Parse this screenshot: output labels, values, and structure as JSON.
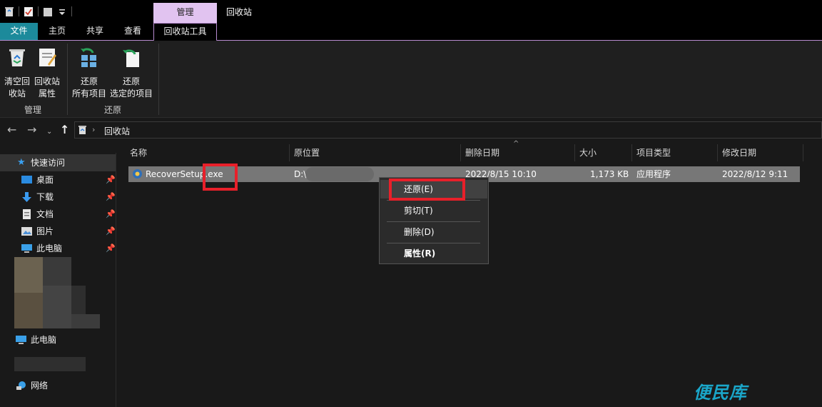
{
  "titlebar": {
    "contextual_tab": "管理",
    "window_title": "回收站",
    "qat_icons": [
      "recycle-bin-icon",
      "properties-icon",
      "folder-icon",
      "dropdown-icon"
    ]
  },
  "ribbon_tabs": {
    "file": "文件",
    "home": "主页",
    "share": "共享",
    "view": "查看",
    "tools": "回收站工具"
  },
  "ribbon": {
    "empty_bin": "清空回收站",
    "empty_bin_l1": "清空回",
    "empty_bin_l2": "收站",
    "bin_props_l1": "回收站",
    "bin_props_l2": "属性",
    "restore_all_l1": "还原",
    "restore_all_l2": "所有项目",
    "restore_sel_l1": "还原",
    "restore_sel_l2": "选定的项目",
    "group_manage": "管理",
    "group_restore": "还原"
  },
  "address": {
    "path": "回收站",
    "icons": [
      "back-arrow-icon",
      "forward-arrow-icon",
      "recent-dropdown-icon",
      "up-arrow-icon",
      "recycle-bin-icon"
    ]
  },
  "sidebar": {
    "quick_access": "快速访问",
    "items": [
      {
        "label": "桌面",
        "icon": "desktop-icon"
      },
      {
        "label": "下载",
        "icon": "download-icon"
      },
      {
        "label": "文档",
        "icon": "document-icon"
      },
      {
        "label": "图片",
        "icon": "pictures-icon"
      },
      {
        "label": "此电脑",
        "icon": "computer-icon"
      }
    ],
    "this_pc": "此电脑",
    "network": "网络"
  },
  "columns": {
    "name": "名称",
    "original_location": "原位置",
    "date_deleted": "删除日期",
    "size": "大小",
    "item_type": "项目类型",
    "date_modified": "修改日期"
  },
  "file_row": {
    "name_prefix": "RecoverSetup",
    "name_suffix": ".exe",
    "location": "D:\\",
    "date_deleted": "2022/8/15 10:10",
    "size": "1,173 KB",
    "type": "应用程序",
    "date_modified": "2022/8/12 9:11"
  },
  "context_menu": {
    "restore": "还原(E)",
    "cut": "剪切(T)",
    "delete": "删除(D)",
    "properties": "属性(R)"
  },
  "watermark": "便民库",
  "colors": {
    "accent_file_tab": "#1c8a9b",
    "contextual_tab": "#e1c3f0",
    "highlight_box": "#e8202a",
    "watermark": "#1aa6c9"
  }
}
